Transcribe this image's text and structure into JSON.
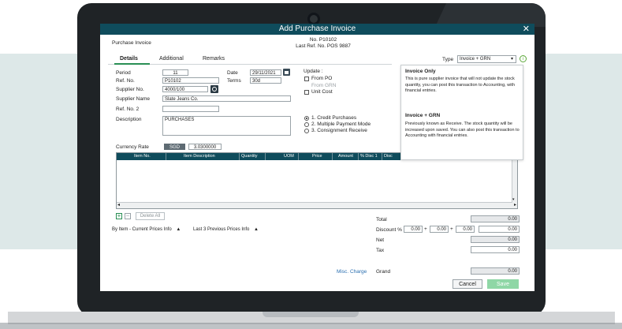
{
  "window": {
    "title": "Add Purchase Invoice",
    "close_glyph": "✕"
  },
  "header": {
    "section": "Purchase Invoice",
    "doc_no": "No. P10102",
    "last_ref": "Last Ref. No. POS 9887"
  },
  "tabs": [
    {
      "label": "Details"
    },
    {
      "label": "Additional"
    },
    {
      "label": "Remarks"
    }
  ],
  "type_select": {
    "label": "Type",
    "value": "Invoice + GRN",
    "arrow": "▾",
    "info_glyph": "i"
  },
  "form": {
    "period_label": "Period",
    "period_value": "11",
    "date_label": "Date",
    "date_value": "29/11/2021",
    "refno_label": "Ref. No.",
    "refno_value": "P10102",
    "terms_label": "Terms",
    "terms_value": "30d",
    "supplier_no_label": "Supplier No.",
    "supplier_no_value": "4000/100",
    "supplier_name_label": "Supplier Name",
    "supplier_name_value": "Slate Jeans Co.",
    "refno2_label": "Ref. No. 2",
    "refno2_value": "",
    "description_label": "Description",
    "description_value": "PURCHASES"
  },
  "update": {
    "label": "Update :",
    "from_po": "From PO",
    "from_grn": "From GRN",
    "unit_cost": "Unit Cost"
  },
  "purchase_options": [
    {
      "label": "1. Credit Purchases",
      "selected": true
    },
    {
      "label": "2. Multiple Payment Mode",
      "selected": false
    },
    {
      "label": "3. Consignment Receive",
      "selected": false
    }
  ],
  "popup": {
    "title1": "Invoice Only",
    "text1": "This is pure supplier invoice that will not update the stock quantity, you can post this transaction to Accounting, with financial entries.",
    "title2": "Invoice + GRN",
    "text2": "Previously known as Receive. The stock quantity will be increased upon saved. You can also post this transaction to Accounting with financial entries."
  },
  "currency": {
    "label": "Currency Rate",
    "code": "SGD",
    "rate": "3.0300000"
  },
  "grid": {
    "columns": [
      "Item No.",
      "Item Description",
      "Quantity",
      "UOM",
      "Price",
      "Amount",
      "% Disc 1",
      "Disc"
    ]
  },
  "grid_actions": {
    "add": "+",
    "remove": "−",
    "delete_all": "Delete All"
  },
  "info_links": {
    "current_prices": "By Item - Current Prices Info",
    "previous_prices": "Last 3 Previous Prices Info",
    "arrow": "▲"
  },
  "totals": {
    "total_label": "Total",
    "total_value": "0.00",
    "discount_label": "Discount %",
    "disc1": "0.00",
    "disc2": "0.00",
    "disc3": "0.00",
    "discount_value": "0.00",
    "net_label": "Net",
    "net_value": "0.00",
    "tax_label": "Tax",
    "tax_value": "0.00",
    "misc_charge": "Misc. Charge",
    "grand_label": "Grand",
    "grand_value": "0.00",
    "plus": "+"
  },
  "buttons": {
    "cancel": "Cancel",
    "save": "Save"
  },
  "colors": {
    "titlebar": "#0f4c5c",
    "save": "#8fd7a6",
    "link": "#2a6fb0",
    "active_tab": "#2a8f55"
  }
}
